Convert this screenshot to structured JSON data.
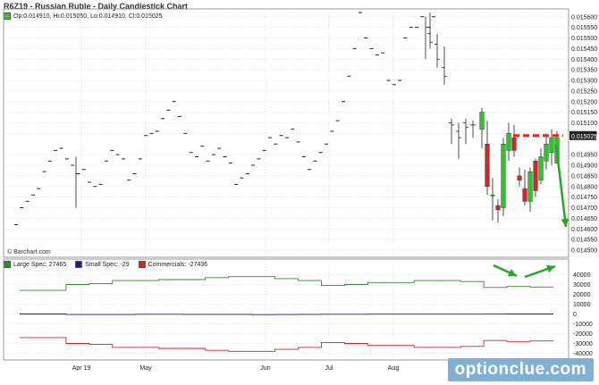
{
  "header": {
    "title": "R6Z19 - Russian Ruble - Daily Candlestick Chart",
    "ohlc_label": "Op:0.014910, Hi:0.015050, Lo:0.014910, Cl:0.015025",
    "source": "© Barchart.com"
  },
  "watermark": "optionclue.com",
  "colors": {
    "bull": "#22cc22",
    "bear": "#dd2222",
    "large_spec": "#2e8b2e",
    "small_spec": "#1a1a99",
    "commercials": "#dd2222",
    "annotation_line": "#ee2222",
    "annotation_arrow": "#22aa22",
    "grid": "#cccccc",
    "price_box": "#222222"
  },
  "annotations": {
    "last_price_label": "0.015025"
  },
  "chart_data": [
    {
      "type": "candlestick",
      "title": "R6Z19 - Russian Ruble - Daily Candlestick Chart",
      "x_ticks": [
        "Apr 19",
        "May",
        "Jun",
        "Jul",
        "Aug"
      ],
      "y_ticks": [
        "0.015600",
        "0.015550",
        "0.015500",
        "0.015450",
        "0.015400",
        "0.015350",
        "0.015300",
        "0.015250",
        "0.015200",
        "0.015150",
        "0.015100",
        "0.015050",
        "0.014950",
        "0.014900",
        "0.014850",
        "0.014800",
        "0.014750",
        "0.014700",
        "0.014650",
        "0.014600",
        "0.014550",
        "0.014500"
      ],
      "ylim": [
        0.0145,
        0.01562
      ],
      "grid": true,
      "dash_prices": [
        0.01462,
        0.0147,
        0.01473,
        0.01476,
        0.01479,
        0.01487,
        0.01492,
        0.01497,
        0.01498,
        0.01493,
        0.0149,
        0.01486,
        0.01488,
        0.01482,
        0.0148,
        0.01481,
        0.01492,
        0.01497,
        0.01495,
        0.01493,
        0.01483,
        0.01486,
        0.01493,
        0.01504,
        0.01505,
        0.01506,
        0.01512,
        0.01516,
        0.0152,
        0.01513,
        0.01505,
        0.01496,
        0.01494,
        0.01499,
        0.01492,
        0.01495,
        0.01498,
        0.01494,
        0.01491,
        0.01481,
        0.01484,
        0.01486,
        0.0149,
        0.01493,
        0.01497,
        0.01503,
        0.015,
        0.01504,
        0.01503,
        0.01507,
        0.01501,
        0.01494,
        0.01488,
        0.01492,
        0.01496,
        0.015,
        0.01506,
        0.01511,
        0.0152,
        0.01532,
        0.01545,
        0.01562,
        0.0155,
        0.01545,
        0.01542,
        0.01543,
        0.0153,
        0.01528,
        0.0153,
        0.0155,
        0.01555,
        0.01555,
        0.0156,
        0.01555,
        0.0156
      ],
      "tail_bars": [
        {
          "o": 0.01552,
          "h": 0.01562,
          "l": 0.01545,
          "c": 0.01548
        },
        {
          "o": 0.01547,
          "h": 0.01552,
          "l": 0.01536,
          "c": 0.0154
        },
        {
          "o": 0.01536,
          "h": 0.01546,
          "l": 0.01528,
          "c": 0.01532
        },
        {
          "o": 0.0151,
          "h": 0.01512,
          "l": 0.015,
          "c": 0.01509
        },
        {
          "o": 0.01506,
          "h": 0.0151,
          "l": 0.01493,
          "c": 0.01503
        },
        {
          "o": 0.0151,
          "h": 0.01512,
          "l": 0.015,
          "c": 0.01508
        },
        {
          "o": 0.01509,
          "h": 0.01511,
          "l": 0.01503,
          "c": 0.01509
        }
      ],
      "candles": [
        {
          "o": 0.01507,
          "h": 0.01517,
          "l": 0.01498,
          "c": 0.01515
        },
        {
          "o": 0.015,
          "h": 0.01511,
          "l": 0.01476,
          "c": 0.0148
        },
        {
          "o": 0.01476,
          "h": 0.01484,
          "l": 0.01464,
          "c": 0.01476
        },
        {
          "o": 0.01471,
          "h": 0.01474,
          "l": 0.01463,
          "c": 0.01469
        },
        {
          "o": 0.0147,
          "h": 0.01503,
          "l": 0.01466,
          "c": 0.015
        },
        {
          "o": 0.01497,
          "h": 0.0151,
          "l": 0.01492,
          "c": 0.01505
        },
        {
          "o": 0.01503,
          "h": 0.01509,
          "l": 0.01494,
          "c": 0.01497
        },
        {
          "o": 0.01485,
          "h": 0.01489,
          "l": 0.0148,
          "c": 0.01483
        },
        {
          "o": 0.01479,
          "h": 0.01488,
          "l": 0.01471,
          "c": 0.01473
        },
        {
          "o": 0.01473,
          "h": 0.01489,
          "l": 0.01468,
          "c": 0.01487
        },
        {
          "o": 0.01492,
          "h": 0.01493,
          "l": 0.01475,
          "c": 0.01478
        },
        {
          "o": 0.01483,
          "h": 0.01498,
          "l": 0.01481,
          "c": 0.01494
        },
        {
          "o": 0.01492,
          "h": 0.01505,
          "l": 0.01488,
          "c": 0.015
        },
        {
          "o": 0.01496,
          "h": 0.01507,
          "l": 0.0149,
          "c": 0.01503
        },
        {
          "o": 0.01491,
          "h": 0.01506,
          "l": 0.01491,
          "c": 0.01503
        }
      ],
      "annotation_level": 0.01504
    },
    {
      "type": "line",
      "title": "",
      "series": [
        {
          "name": "Large Spec: 27465",
          "values": [
            24000,
            24000,
            30000,
            31000,
            34000,
            34000,
            35000,
            35000,
            37000,
            38000,
            38000,
            36000,
            34000,
            29000,
            30000,
            32000,
            32000,
            34000,
            34000,
            33000,
            27000,
            28000,
            27500
          ]
        },
        {
          "name": "Small Spec: -29",
          "values": [
            0,
            0,
            -500,
            -500,
            -500,
            -300,
            -300,
            -400,
            -400,
            -400,
            -600,
            -500,
            -400,
            -300,
            -300,
            -200,
            -200,
            -200,
            -200,
            -200,
            -100,
            0,
            -29
          ]
        },
        {
          "name": "Commercials: -27436",
          "values": [
            -24000,
            -24000,
            -30000,
            -31000,
            -34000,
            -34000,
            -35000,
            -35000,
            -37000,
            -38000,
            -38000,
            -36000,
            -34000,
            -29000,
            -30000,
            -32000,
            -32000,
            -34000,
            -34000,
            -33000,
            -27000,
            -28000,
            -27436
          ]
        }
      ],
      "y_ticks": [
        "40000",
        "30000",
        "20000",
        "10000",
        "0",
        "-10000",
        "-20000",
        "-30000",
        "-40000"
      ],
      "ylim": [
        -45000,
        45000
      ]
    }
  ]
}
